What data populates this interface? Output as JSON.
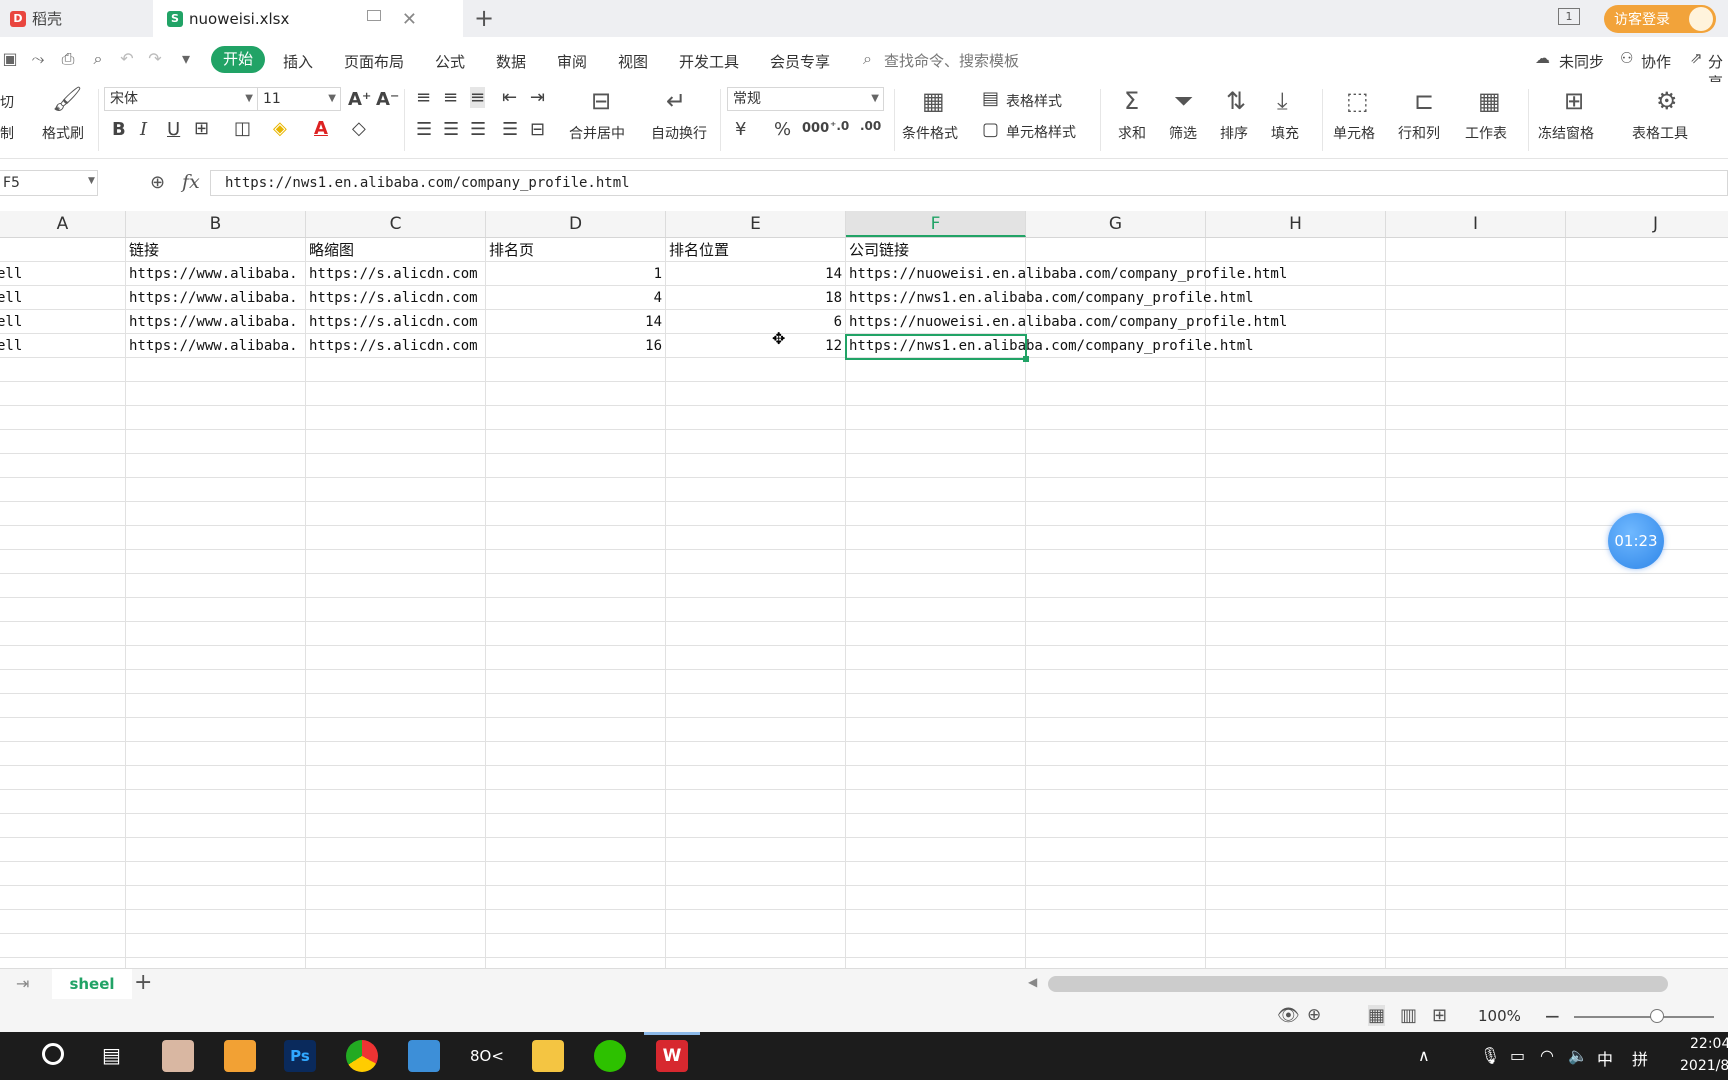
{
  "tabs": {
    "tab1": "稻壳",
    "tab2": "nuoweisi.xlsx",
    "login": "访客登录",
    "window_badge": "1"
  },
  "menu": {
    "items": [
      "开始",
      "插入",
      "页面布局",
      "公式",
      "数据",
      "审阅",
      "视图",
      "开发工具",
      "会员专享"
    ],
    "search_placeholder": "查找命令、搜索模板",
    "sync": "未同步",
    "collab": "协作",
    "share": "分享"
  },
  "ribbon": {
    "cut": "剪切",
    "copy": "复制",
    "format_painter": "格式刷",
    "font_name": "宋体",
    "font_size": "11",
    "merge_center": "合并居中",
    "wrap": "自动换行",
    "number_format": "常规",
    "cond_format": "条件格式",
    "table_style": "表格样式",
    "cell_style": "单元格样式",
    "sum": "求和",
    "filter": "筛选",
    "sort": "排序",
    "fill": "填充",
    "cell": "单元格",
    "row_col": "行和列",
    "worksheet": "工作表",
    "freeze": "冻结窗格",
    "table_tools": "表格工具"
  },
  "formula_bar": {
    "name_box": "F5",
    "fx": "fx",
    "value": "https://nws1.en.alibaba.com/company_profile.html"
  },
  "columns": [
    "A",
    "B",
    "C",
    "D",
    "E",
    "F",
    "G",
    "H",
    "I",
    "J"
  ],
  "header_row": {
    "A": "",
    "B": "链接",
    "C": "略缩图",
    "D": "排名页",
    "E": "排名位置",
    "F": "公司链接"
  },
  "rows": [
    {
      "A": "ell",
      "B": "https://www.alibaba.",
      "C": "https://s.alicdn.com",
      "D": "1",
      "E": "14",
      "F": "https://nuoweisi.en.alibaba.com/company_profile.html"
    },
    {
      "A": "ell",
      "B": "https://www.alibaba.",
      "C": "https://s.alicdn.com",
      "D": "4",
      "E": "18",
      "F": "https://nws1.en.alibaba.com/company_profile.html"
    },
    {
      "A": "ell",
      "B": "https://www.alibaba.",
      "C": "https://s.alicdn.com",
      "D": "14",
      "E": "6",
      "F": "https://nuoweisi.en.alibaba.com/company_profile.html"
    },
    {
      "A": "ell",
      "B": "https://www.alibaba.",
      "C": "https://s.alicdn.com",
      "D": "16",
      "E": "12",
      "F": "https://nws1.en.alibaba.com/company_profile.html"
    }
  ],
  "sheet": {
    "name": "sheel"
  },
  "status": {
    "zoom": "100%"
  },
  "timer": "01:23",
  "taskbar": {
    "clock": "22:04",
    "date": "2021/8",
    "ime1": "中",
    "ime2": "拼"
  },
  "colors": {
    "accent": "#21a366",
    "login": "#f2a33a"
  }
}
